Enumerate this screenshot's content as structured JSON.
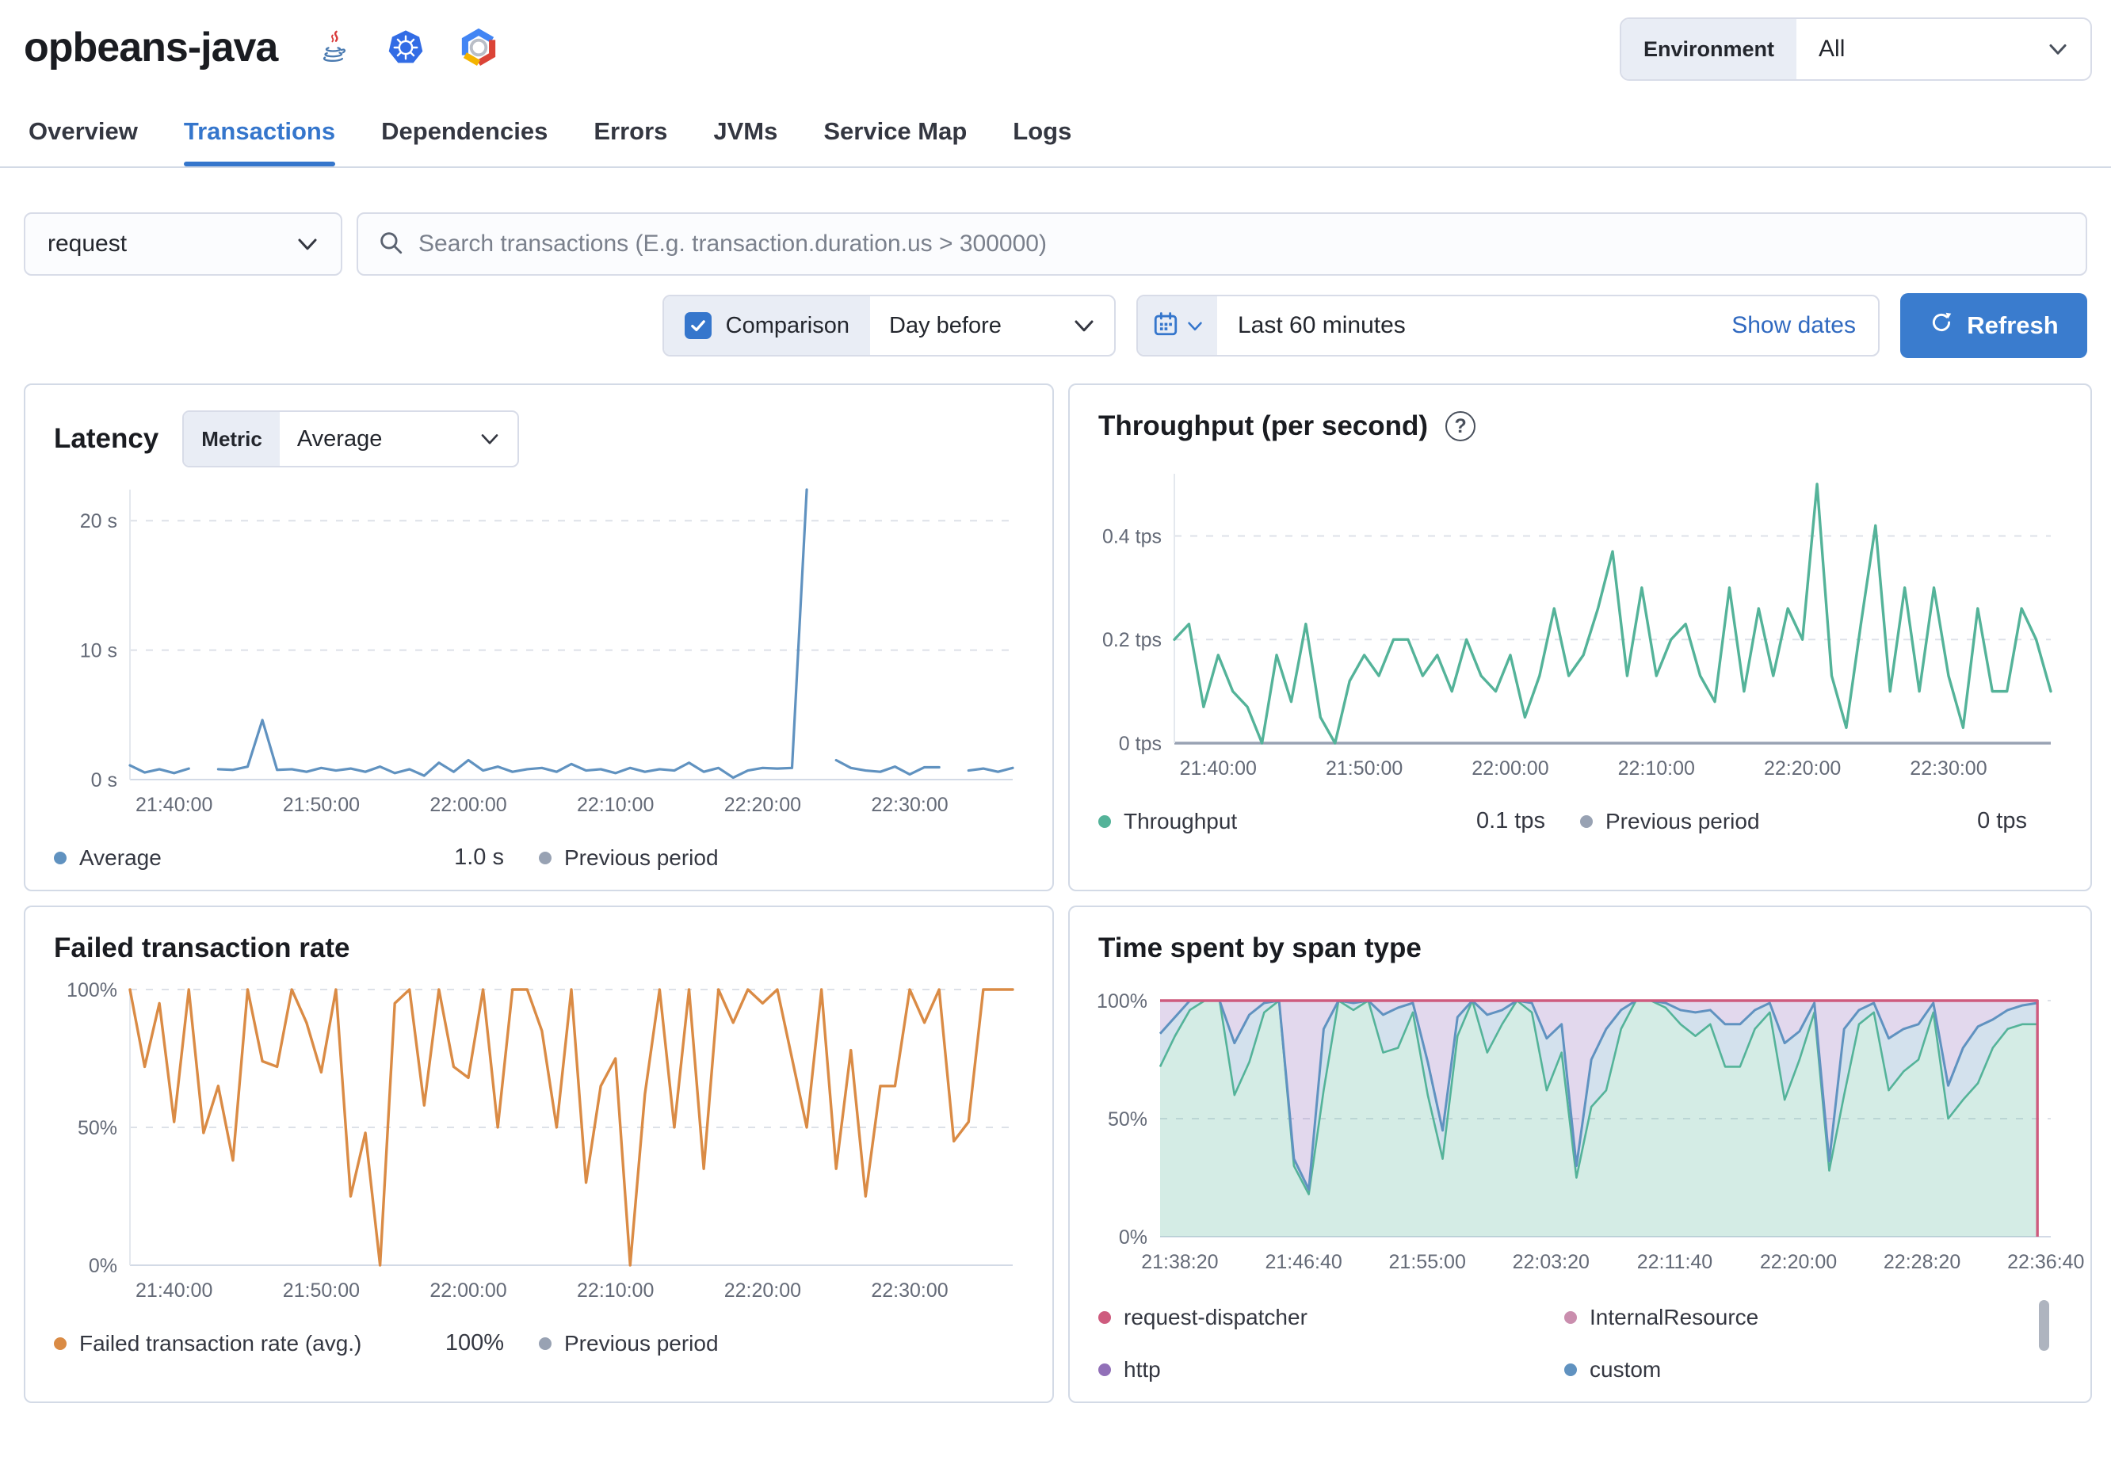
{
  "header": {
    "title": "opbeans-java",
    "environment_label": "Environment",
    "environment_value": "All"
  },
  "tabs": [
    {
      "label": "Overview",
      "active": false
    },
    {
      "label": "Transactions",
      "active": true
    },
    {
      "label": "Dependencies",
      "active": false
    },
    {
      "label": "Errors",
      "active": false
    },
    {
      "label": "JVMs",
      "active": false
    },
    {
      "label": "Service Map",
      "active": false
    },
    {
      "label": "Logs",
      "active": false
    }
  ],
  "filters": {
    "transaction_type": "request",
    "search_placeholder": "Search transactions (E.g. transaction.duration.us > 300000)",
    "comparison_label": "Comparison",
    "comparison_checked": true,
    "comparison_value": "Day before",
    "time_range": "Last 60 minutes",
    "show_dates_label": "Show dates",
    "refresh_label": "Refresh"
  },
  "colors": {
    "accent": "#3576cc",
    "latency_line": "#6092C0",
    "throughput_line": "#54B399",
    "failed_line": "#DA8B45",
    "previous_period": "#98A2B3",
    "span_request_dispatcher": "#CE5B7E",
    "span_internal_resource": "#CA8EAE",
    "span_http": "#9170B8",
    "span_custom": "#6092C0",
    "span_app_green": "#54B399"
  },
  "chart_data": [
    {
      "type": "line",
      "title": "Latency",
      "metric_label": "Metric",
      "metric_value": "Average",
      "x_domain": [
        0,
        60
      ],
      "y_max": 22.4,
      "y_ticks": [
        {
          "v": 0,
          "label": "0 s"
        },
        {
          "v": 10,
          "label": "10 s"
        },
        {
          "v": 20,
          "label": "20 s"
        }
      ],
      "x_ticks": [
        {
          "v": 3,
          "label": "21:40:00"
        },
        {
          "v": 13,
          "label": "21:50:00"
        },
        {
          "v": 23,
          "label": "22:00:00"
        },
        {
          "v": 33,
          "label": "22:10:00"
        },
        {
          "v": 43,
          "label": "22:20:00"
        },
        {
          "v": 53,
          "label": "22:30:00"
        }
      ],
      "series": [
        {
          "name": "Average",
          "color": "#6092C0",
          "width": 3.2,
          "values": [
            1.1,
            0.55,
            0.8,
            0.5,
            0.85,
            null,
            0.8,
            0.75,
            1.0,
            4.6,
            0.75,
            0.8,
            0.6,
            0.9,
            0.7,
            0.85,
            0.6,
            1.0,
            0.5,
            0.8,
            0.3,
            1.3,
            0.6,
            1.5,
            0.7,
            1.0,
            0.6,
            0.8,
            0.9,
            0.6,
            1.2,
            0.7,
            0.8,
            0.5,
            0.9,
            0.6,
            0.8,
            0.7,
            1.3,
            0.6,
            0.9,
            0.15,
            0.7,
            0.9,
            0.85,
            0.9,
            22.4,
            null,
            1.5,
            0.9,
            0.7,
            0.6,
            1.0,
            0.4,
            0.95,
            0.95,
            null,
            0.7,
            0.85,
            0.6,
            0.9
          ]
        }
      ],
      "legend": [
        {
          "label": "Average",
          "color": "#6092C0",
          "value": "1.0 s"
        },
        {
          "label": "Previous period",
          "color": "#98A2B3",
          "value": ""
        }
      ]
    },
    {
      "type": "line",
      "title": "Throughput (per second)",
      "has_help_icon": true,
      "x_domain": [
        0,
        60
      ],
      "y_max": 0.52,
      "y_ticks": [
        {
          "v": 0,
          "label": "0 tps"
        },
        {
          "v": 0.2,
          "label": "0.2 tps"
        },
        {
          "v": 0.4,
          "label": "0.4 tps"
        }
      ],
      "x_ticks": [
        {
          "v": 3,
          "label": "21:40:00"
        },
        {
          "v": 13,
          "label": "21:50:00"
        },
        {
          "v": 23,
          "label": "22:00:00"
        },
        {
          "v": 33,
          "label": "22:10:00"
        },
        {
          "v": 43,
          "label": "22:20:00"
        },
        {
          "v": 53,
          "label": "22:30:00"
        }
      ],
      "baseline_color": "#98A2B3",
      "baseline_width": 3.5,
      "series": [
        {
          "name": "Throughput",
          "color": "#54B399",
          "width": 3.4,
          "values": [
            0.2,
            0.23,
            0.07,
            0.17,
            0.1,
            0.07,
            0.0,
            0.17,
            0.08,
            0.23,
            0.05,
            0.0,
            0.12,
            0.17,
            0.13,
            0.2,
            0.2,
            0.13,
            0.17,
            0.1,
            0.2,
            0.13,
            0.1,
            0.17,
            0.05,
            0.13,
            0.26,
            0.13,
            0.17,
            0.26,
            0.37,
            0.13,
            0.3,
            0.13,
            0.2,
            0.23,
            0.13,
            0.08,
            0.3,
            0.1,
            0.26,
            0.13,
            0.26,
            0.2,
            0.5,
            0.13,
            0.03,
            0.23,
            0.42,
            0.1,
            0.3,
            0.1,
            0.3,
            0.13,
            0.03,
            0.26,
            0.1,
            0.1,
            0.26,
            0.2,
            0.1
          ]
        }
      ],
      "legend": [
        {
          "label": "Throughput",
          "color": "#54B399",
          "value": "0.1 tps"
        },
        {
          "label": "Previous period",
          "color": "#98A2B3",
          "value": "0 tps"
        }
      ]
    },
    {
      "type": "line",
      "title": "Failed transaction rate",
      "x_domain": [
        0,
        60
      ],
      "y_max": 100,
      "y_ticks": [
        {
          "v": 0,
          "label": "0%"
        },
        {
          "v": 50,
          "label": "50%"
        },
        {
          "v": 100,
          "label": "100%"
        }
      ],
      "x_ticks": [
        {
          "v": 3,
          "label": "21:40:00"
        },
        {
          "v": 13,
          "label": "21:50:00"
        },
        {
          "v": 23,
          "label": "22:00:00"
        },
        {
          "v": 33,
          "label": "22:10:00"
        },
        {
          "v": 43,
          "label": "22:20:00"
        },
        {
          "v": 53,
          "label": "22:30:00"
        }
      ],
      "series": [
        {
          "name": "Failed transaction rate (avg.)",
          "color": "#DA8B45",
          "width": 3.4,
          "values": [
            100,
            72,
            95,
            52,
            100,
            48,
            65,
            38,
            100,
            74,
            72,
            100,
            88,
            70,
            100,
            25,
            48,
            0,
            95,
            100,
            58,
            100,
            72,
            68,
            100,
            50,
            100,
            100,
            85,
            50,
            100,
            30,
            65,
            75,
            0,
            62,
            100,
            50,
            100,
            35,
            100,
            88,
            100,
            95,
            100,
            75,
            50,
            100,
            35,
            78,
            25,
            65,
            65,
            100,
            88,
            100,
            45,
            52,
            100,
            100,
            100
          ]
        }
      ],
      "legend": [
        {
          "label": "Failed transaction rate (avg.)",
          "color": "#DA8B45",
          "value": "100%"
        },
        {
          "label": "Previous period",
          "color": "#98A2B3",
          "value": ""
        }
      ]
    },
    {
      "type": "span_area",
      "title": "Time spent by span type",
      "x_domain": [
        0,
        60
      ],
      "y_max": 100,
      "y_ticks": [
        {
          "v": 0,
          "label": "0%"
        },
        {
          "v": 50,
          "label": "50%"
        },
        {
          "v": 100,
          "label": "100%"
        }
      ],
      "x_ticks": [
        {
          "v": 1.33,
          "label": "21:38:20"
        },
        {
          "v": 9.67,
          "label": "21:46:40"
        },
        {
          "v": 18,
          "label": "21:55:00"
        },
        {
          "v": 26.33,
          "label": "22:03:20"
        },
        {
          "v": 34.67,
          "label": "22:11:40"
        },
        {
          "v": 43,
          "label": "22:20:00"
        },
        {
          "v": 51.33,
          "label": "22:28:20"
        },
        {
          "v": 59.67,
          "label": "22:36:40"
        }
      ],
      "green_boundary": [
        72,
        85,
        96,
        100,
        100,
        60,
        74,
        95,
        100,
        30,
        18,
        62,
        100,
        96,
        100,
        78,
        80,
        95,
        60,
        33,
        85,
        100,
        78,
        90,
        100,
        95,
        62,
        78,
        25,
        55,
        62,
        88,
        100,
        100,
        97,
        90,
        85,
        90,
        72,
        72,
        88,
        95,
        58,
        75,
        95,
        28,
        60,
        90,
        95,
        62,
        70,
        75,
        95,
        50,
        58,
        65,
        80,
        88,
        90,
        90
      ],
      "blue_boundary": [
        86,
        93,
        100,
        100,
        100,
        82,
        94,
        99,
        100,
        33,
        20,
        88,
        100,
        99,
        100,
        94,
        97,
        99,
        74,
        45,
        93,
        100,
        94,
        96,
        100,
        99,
        84,
        90,
        30,
        75,
        88,
        96,
        100,
        100,
        99,
        96,
        95,
        96,
        90,
        90,
        96,
        99,
        82,
        87,
        99,
        32,
        88,
        96,
        99,
        84,
        88,
        90,
        99,
        64,
        80,
        89,
        92,
        96,
        98,
        99
      ],
      "top_value": 100,
      "colors": {
        "green_line": "#54B399",
        "green_fill": "rgba(84,179,153,0.25)",
        "blue_line": "#6092C0",
        "blue_fill": "rgba(96,146,192,0.28)",
        "purple_fill": "rgba(150,115,190,0.28)",
        "rose_line": "#CE5B7E"
      },
      "legend": [
        {
          "label": "request-dispatcher",
          "color": "#CE5B7E"
        },
        {
          "label": "InternalResource",
          "color": "#CA8EAE"
        },
        {
          "label": "http",
          "color": "#9170B8"
        },
        {
          "label": "custom",
          "color": "#6092C0"
        }
      ]
    }
  ]
}
